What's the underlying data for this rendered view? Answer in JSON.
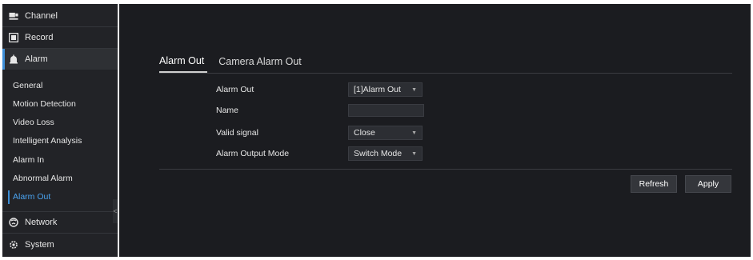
{
  "sidebar": {
    "top_items": [
      {
        "label": "Channel",
        "icon": "channel-icon"
      },
      {
        "label": "Record",
        "icon": "record-icon"
      },
      {
        "label": "Alarm",
        "icon": "alarm-icon"
      }
    ],
    "alarm_sub_items": [
      {
        "label": "General"
      },
      {
        "label": "Motion Detection"
      },
      {
        "label": "Video Loss"
      },
      {
        "label": "Intelligent Analysis"
      },
      {
        "label": "Alarm In"
      },
      {
        "label": "Abnormal Alarm"
      },
      {
        "label": "Alarm Out"
      }
    ],
    "bottom_items": [
      {
        "label": "Network",
        "icon": "network-icon"
      },
      {
        "label": "System",
        "icon": "system-icon"
      }
    ],
    "collapse_glyph": "<"
  },
  "main": {
    "tabs": [
      {
        "label": "Alarm Out"
      },
      {
        "label": "Camera Alarm Out"
      }
    ],
    "form": {
      "alarm_out": {
        "label": "Alarm Out",
        "value": "[1]Alarm Out"
      },
      "name": {
        "label": "Name",
        "value": ""
      },
      "valid_signal": {
        "label": "Valid signal",
        "value": "Close"
      },
      "output_mode": {
        "label": "Alarm Output Mode",
        "value": "Switch Mode"
      }
    },
    "buttons": {
      "refresh": "Refresh",
      "apply": "Apply"
    }
  },
  "colors": {
    "sidebar_bg": "#222327",
    "main_bg": "#1b1c20",
    "accent": "#3d8fd8",
    "active_sub_text": "#4aa3f0"
  }
}
